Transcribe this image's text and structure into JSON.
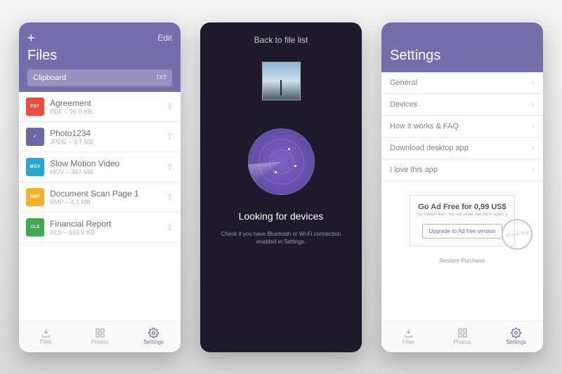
{
  "phone1": {
    "edit": "Edit",
    "title": "Files",
    "clipboard": {
      "label": "Clipboard",
      "ext": "TXT"
    },
    "files": [
      {
        "name": "Agreement",
        "meta": "PDF – 96.0 KB",
        "badge": "PDF",
        "color": "#f04b3c"
      },
      {
        "name": "Photo1234",
        "meta": "JPEG – 3.7 MB",
        "badge": "✓",
        "color": "#6d67a6"
      },
      {
        "name": "Slow Motion Video",
        "meta": "MOV – 387 MB",
        "badge": "MOV",
        "color": "#2aa6d1"
      },
      {
        "name": "Document Scan Page 1",
        "meta": "BMP – 4.1 MB",
        "badge": "BMP",
        "color": "#f2b22a"
      },
      {
        "name": "Financial Report",
        "meta": "XLS – 616.0 KB",
        "badge": "XLS",
        "color": "#3eaa52"
      }
    ]
  },
  "tabs": {
    "files": "Files",
    "photos": "Photos",
    "settings": "Settings"
  },
  "phone2": {
    "back": "Back to file list",
    "title": "Looking for devices",
    "sub": "Check if you have Bluetooth or Wi-Fi connection enabled in Settings."
  },
  "phone3": {
    "title": "Settings",
    "rows": [
      "General",
      "Devices",
      "How it works & FAQ",
      "Download desktop app",
      "I love this app"
    ],
    "adfree": {
      "title": "Go Ad Free for 0,99 US$",
      "sub": "No hidden fees. You will never see them again :)",
      "btn": "Upgrade to Ad free version",
      "stamp": "Thank You"
    },
    "restore": "Restore Purchase"
  }
}
